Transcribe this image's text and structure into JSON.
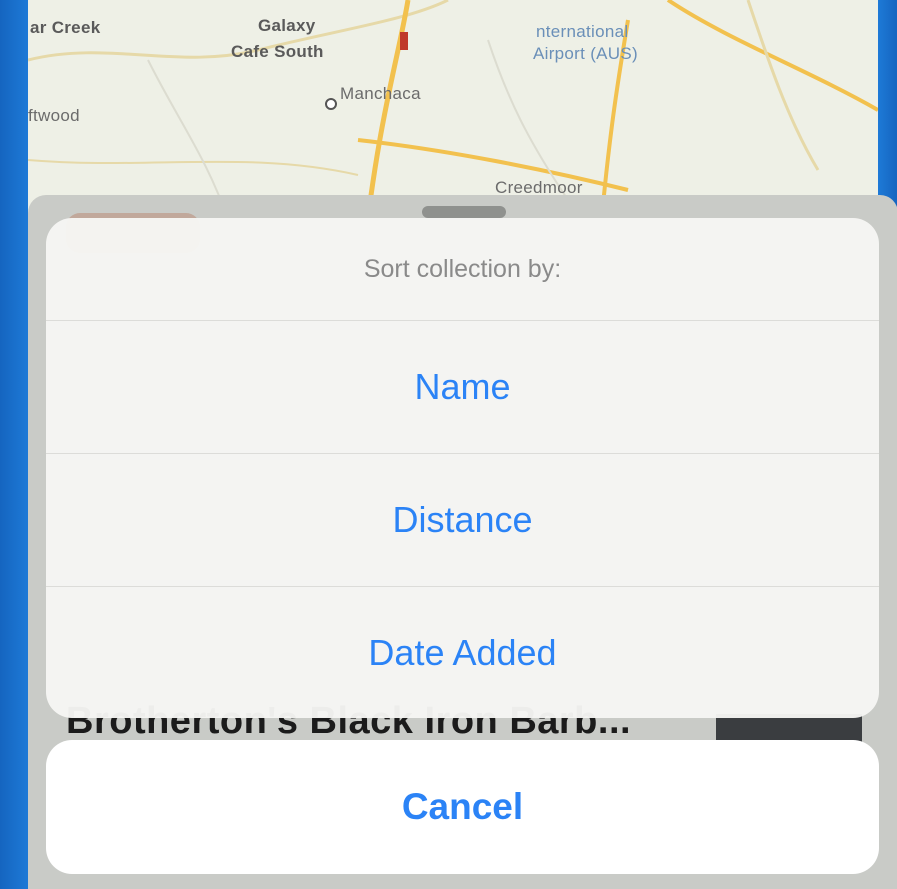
{
  "map": {
    "labels": {
      "creek": "ar Creek",
      "galaxy": "Galaxy",
      "cafe": "Cafe South",
      "manchaca": "Manchaca",
      "driftwood": "ftwood",
      "airport1": "nternational",
      "airport2": "Airport (AUS)",
      "creedmoor": "Creedmoor"
    }
  },
  "background_list": {
    "item_title": "Brotherton's Black Iron Barb..."
  },
  "action_sheet": {
    "title": "Sort collection by:",
    "options": [
      "Name",
      "Distance",
      "Date Added"
    ],
    "cancel": "Cancel"
  },
  "colors": {
    "accent": "#2b83f6",
    "frame": "#1a73c8"
  }
}
